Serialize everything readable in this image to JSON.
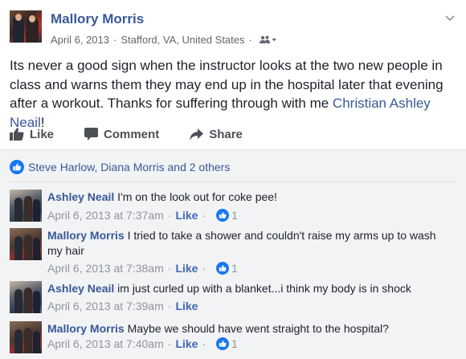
{
  "post": {
    "author": "Mallory Morris",
    "date": "April 6, 2013",
    "separator": "·",
    "location": "Stafford, VA, United States",
    "text_before_tag": "Its never a good sign when the instructor looks at the two new people in class and warns them they may end up in the hospital later that evening after a workout. Thanks for suffering through with me ",
    "tagged_person": "Christian Ashley Neail",
    "text_after_tag": "!"
  },
  "actions": {
    "like": "Like",
    "comment": "Comment",
    "share": "Share"
  },
  "likes_summary": "Steve Harlow, Diana Morris and 2 others",
  "comments": [
    {
      "author": "Ashley Neail",
      "text": "I'm on the look out for coke pee!",
      "time": "April 6, 2013 at 7:37am",
      "like_label": "Like",
      "reactions": "1"
    },
    {
      "author": "Mallory Morris",
      "text": "I tried to take a shower and couldn't raise my arms up to wash my hair",
      "time": "April 6, 2013 at 7:38am",
      "like_label": "Like",
      "reactions": "1"
    },
    {
      "author": "Ashley Neail",
      "text": "im just curled up with a blanket...i think my body is in shock",
      "time": "April 6, 2013 at 7:39am",
      "like_label": "Like",
      "reactions": ""
    },
    {
      "author": "Mallory Morris",
      "text": "Maybe we should have went straight to the hospital?",
      "time": "April 6, 2013 at 7:40am",
      "like_label": "Like",
      "reactions": "1"
    }
  ],
  "icons": {
    "privacy": "friends-audience-icon",
    "menu": "chevron-down-icon",
    "like": "thumbs-up-icon",
    "comment": "speech-bubble-icon",
    "share": "share-arrow-icon",
    "reaction": "like-reaction-icon"
  },
  "colors": {
    "link": "#385898",
    "muted": "#606770",
    "action": "#4b4f56",
    "reaction_blue": "#1877f2",
    "comments_bg": "#f2f3f5"
  }
}
